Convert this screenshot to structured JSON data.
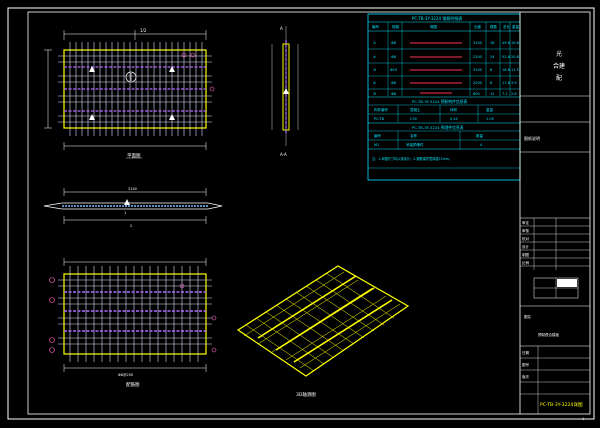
{
  "drawing": {
    "plan_label": "平面图",
    "section_label": "A-A",
    "side_label": "侧立面",
    "elevation_label": "立面图",
    "rebar_label": "配筋图",
    "iso_label": "3D轴测图",
    "dim_width": "3140",
    "dim_half": "1/2",
    "dim_rebar": "Φ8@200",
    "axis_a": "A",
    "axis_b": "B",
    "mark_1": "1",
    "mark_2": "2"
  },
  "steel_table": {
    "title": "PC-TB-3Y-3224 钢筋明细表",
    "headers": [
      "编号",
      "规格",
      "简图",
      "长度",
      "根数",
      "总长",
      "重量"
    ],
    "rows": [
      [
        "①",
        "Φ8",
        "",
        "3100",
        "16",
        "49.6",
        "19.6"
      ],
      [
        "②",
        "Φ8",
        "",
        "2200",
        "24",
        "52.8",
        "20.8"
      ],
      [
        "③",
        "Φ10",
        "",
        "3100",
        "6",
        "18.6",
        "11.5"
      ],
      [
        "④",
        "Φ6",
        "",
        "2200",
        "8",
        "17.6",
        "3.9"
      ],
      [
        "⑤",
        "Φ8",
        "",
        "600",
        "12",
        "7.2",
        "2.8"
      ]
    ],
    "sub_title": "PC-TB-3Y-3224 预制构件信息表",
    "sub_headers": [
      "构件编号",
      "混凝土",
      "体积",
      "重量"
    ],
    "sub_row": [
      "PC-TB",
      "C30",
      "0.42",
      "1.05"
    ],
    "sub_title2": "PC-TB-3Y-3224 预埋件信息表",
    "sub2_headers": [
      "编号",
      "名称",
      "数量"
    ],
    "sub2_row": [
      "M1",
      "吊装预埋件",
      "4"
    ],
    "note": "注：1.本图尺寸均以毫米计；2.钢筋保护层厚度15mm。"
  },
  "title_block": {
    "company_1": "光",
    "company_2": "合建",
    "company_3": "配",
    "project_note": "图纸说明",
    "field_labels": [
      "审定",
      "审核",
      "校对",
      "设计",
      "制图",
      "比例"
    ],
    "drawing_name_label": "图名",
    "drawing_name": "预制叠合楼板",
    "date_label": "日期",
    "sheet_label": "图号",
    "version_label": "版次",
    "code": "PC-TB-3Y-3224详图",
    "page": "1"
  }
}
